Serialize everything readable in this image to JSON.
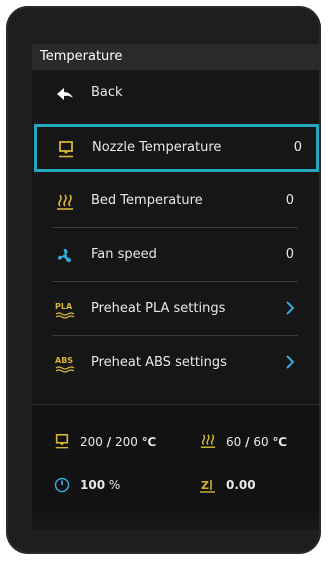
{
  "title": "Temperature",
  "menu": {
    "back_label": "Back",
    "nozzle": {
      "label": "Nozzle Temperature",
      "value": "0"
    },
    "bed": {
      "label": "Bed Temperature",
      "value": "0"
    },
    "fan": {
      "label": "Fan speed",
      "value": "0"
    },
    "pla": {
      "label": "Preheat PLA settings",
      "icon_text": "PLA"
    },
    "abs": {
      "label": "Preheat ABS settings",
      "icon_text": "ABS"
    }
  },
  "status": {
    "nozzle_current": "200",
    "nozzle_sep": "/",
    "nozzle_target": "200",
    "nozzle_unit": "℃",
    "bed_current": "60",
    "bed_sep": "/",
    "bed_target": "60",
    "bed_unit": "℃",
    "fan_value": "100",
    "fan_unit": "%",
    "z_value": "0.00"
  },
  "colors": {
    "accent": "#23a6bd",
    "background": "#161616",
    "title_bg": "#2a2a2a",
    "text": "#e8e8e8"
  }
}
